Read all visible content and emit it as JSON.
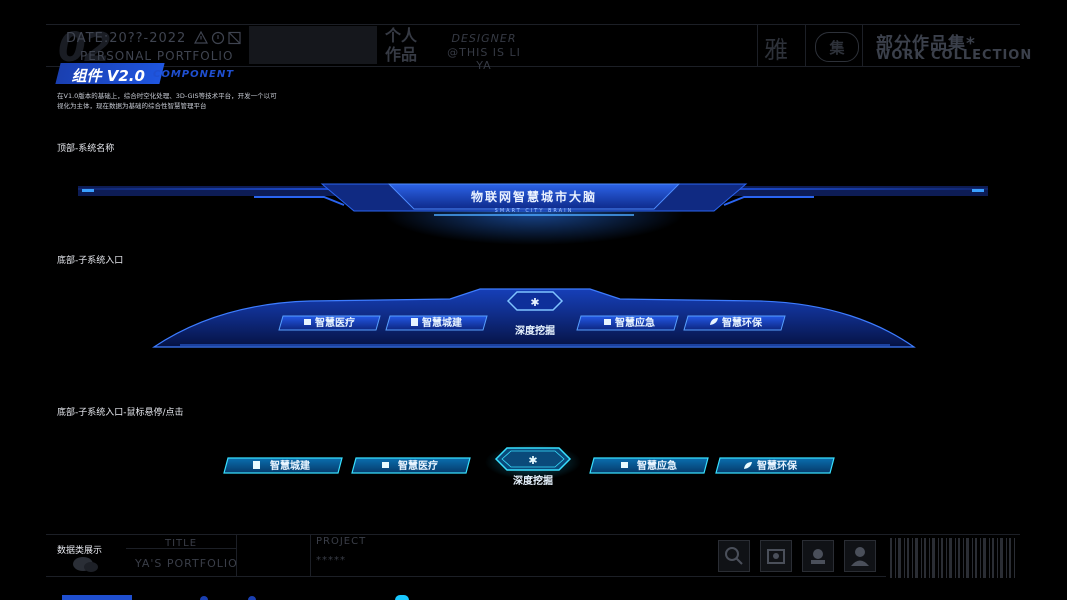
{
  "header": {
    "number": "02",
    "date": "DATE:20??-2022",
    "personal_portfolio": "PERSONAL PORTFOLIO",
    "personal_works_line1": "个人",
    "personal_works_line2": "作品",
    "designer": "DESIGNER",
    "designer_name": "@THIS IS LI YA",
    "ya_char": "雅",
    "collection_badge_char": "集",
    "collection_title": "部分作品集*",
    "collection_subtitle": "WORK COLLECTION"
  },
  "section": {
    "title": "组件 V2.0",
    "subtitle": "COMPONENT",
    "description_line1": "在V1.0版本的基础上，综合时空化处理、3D-GIS等技术平台，开发一个以可",
    "description_line2": "视化为主体，现在数据为基础的综合性智慧管理平台"
  },
  "top_component": {
    "label": "顶部-系统名称",
    "system_name": "物联网智慧城市大脑",
    "system_name_en": "SMART CITY BRAIN"
  },
  "bottom_nav": {
    "label": "底部-子系统入口",
    "items": [
      {
        "label": "智慧医疗",
        "icon": "medical-icon"
      },
      {
        "label": "智慧城建",
        "icon": "building-icon"
      },
      {
        "label": "深度挖掘",
        "icon": "snowflake-icon"
      },
      {
        "label": "智慧应急",
        "icon": "emergency-icon"
      },
      {
        "label": "智慧环保",
        "icon": "leaf-icon"
      }
    ]
  },
  "hover_nav": {
    "label": "底部-子系统入口-鼠标悬停/点击",
    "items": [
      {
        "label": "智慧城建",
        "icon": "building-icon"
      },
      {
        "label": "智慧医疗",
        "icon": "medical-icon"
      },
      {
        "label": "深度挖掘",
        "icon": "snowflake-icon"
      },
      {
        "label": "智慧应急",
        "icon": "emergency-icon"
      },
      {
        "label": "智慧环保",
        "icon": "leaf-icon"
      }
    ]
  },
  "data_section": {
    "label": "数据类展示"
  },
  "footer": {
    "title_label": "TITLE",
    "title_value": "YA'S PORTFOLIO",
    "project_label": "PROJECT",
    "project_value": "*****"
  },
  "colors": {
    "accent_blue": "#1f56e0",
    "glow_blue": "#2b7cff",
    "cyan": "#18c8ff"
  }
}
